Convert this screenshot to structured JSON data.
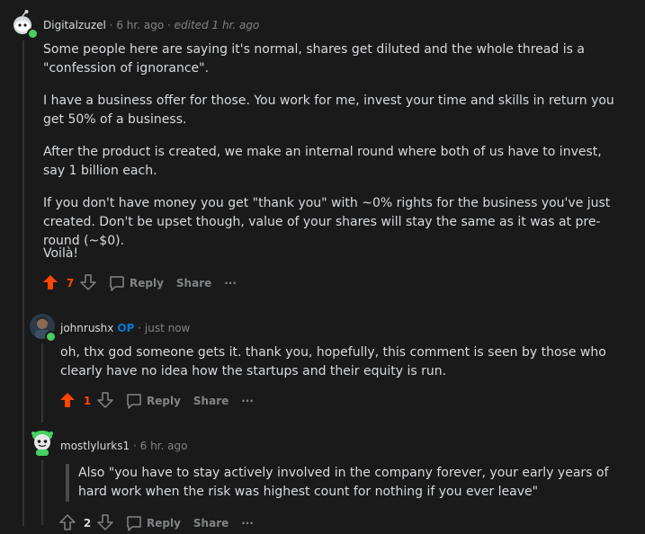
{
  "comments": [
    {
      "username": "Digitalzuzel",
      "time": "6 hr. ago",
      "edited": "edited 1 hr. ago",
      "paragraphs": [
        "Some people here are saying it's normal, shares get diluted and the whole thread is a \"confession of ignorance\".",
        "I have a business offer for those. You work for me, invest your time and skills in return you get 50% of a business.",
        "After the product is created, we make an internal round where both of us have to invest, say 1 billion each.",
        "If you don't have money you get \"thank you\" with ~0% rights for the business you've just created. Don't be upset though, value of your shares will stay the same as it was at pre-round (~$0).",
        "Voilà!"
      ],
      "score": "7",
      "reply_label": "Reply",
      "share_label": "Share",
      "more_label": "···"
    },
    {
      "username": "johnrushx",
      "op_badge": "OP",
      "time": "just now",
      "paragraphs": [
        "oh, thx god someone gets it. thank you, hopefully, this comment is seen by those who clearly have no idea how the startups and their equity is run."
      ],
      "score": "1",
      "reply_label": "Reply",
      "share_label": "Share",
      "more_label": "···"
    },
    {
      "username": "mostlylurks1",
      "time": "6 hr. ago",
      "quote": "Also \"you have to stay actively involved in the company forever, your early years of hard work when the risk was highest count for nothing if you ever leave\"",
      "score": "2",
      "reply_label": "Reply",
      "share_label": "Share",
      "more_label": "···"
    }
  ],
  "separator": "·",
  "colors": {
    "background": "#1a1a1b",
    "upvote_active": "#ff4500",
    "op_badge": "#0079d3",
    "online": "#46d160"
  }
}
